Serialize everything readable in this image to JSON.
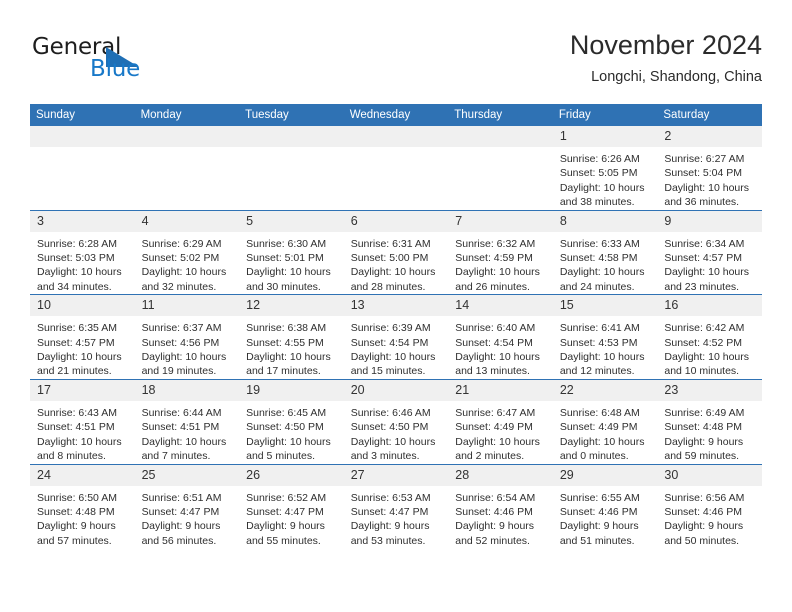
{
  "logo": {
    "word_one": "General",
    "word_two": "Blue",
    "triangle_icon": "blue-triangle-icon",
    "brand_blue": "#1878c8",
    "triangle_blue": "#1f6fb5"
  },
  "header": {
    "title": "November 2024",
    "subtitle": "Longchi, Shandong, China"
  },
  "theme": {
    "header_blue": "#2f72b4",
    "daynum_bg": "#f0f0f0",
    "page_bg": "#ffffff"
  },
  "calendar": {
    "weekday_headers": [
      "Sunday",
      "Monday",
      "Tuesday",
      "Wednesday",
      "Thursday",
      "Friday",
      "Saturday"
    ],
    "weeks": [
      [
        {
          "day": "",
          "empty": true
        },
        {
          "day": "",
          "empty": true
        },
        {
          "day": "",
          "empty": true
        },
        {
          "day": "",
          "empty": true
        },
        {
          "day": "",
          "empty": true
        },
        {
          "day": "1",
          "sunrise": "Sunrise: 6:26 AM",
          "sunset": "Sunset: 5:05 PM",
          "daylight": "Daylight: 10 hours and 38 minutes."
        },
        {
          "day": "2",
          "sunrise": "Sunrise: 6:27 AM",
          "sunset": "Sunset: 5:04 PM",
          "daylight": "Daylight: 10 hours and 36 minutes."
        }
      ],
      [
        {
          "day": "3",
          "sunrise": "Sunrise: 6:28 AM",
          "sunset": "Sunset: 5:03 PM",
          "daylight": "Daylight: 10 hours and 34 minutes."
        },
        {
          "day": "4",
          "sunrise": "Sunrise: 6:29 AM",
          "sunset": "Sunset: 5:02 PM",
          "daylight": "Daylight: 10 hours and 32 minutes."
        },
        {
          "day": "5",
          "sunrise": "Sunrise: 6:30 AM",
          "sunset": "Sunset: 5:01 PM",
          "daylight": "Daylight: 10 hours and 30 minutes."
        },
        {
          "day": "6",
          "sunrise": "Sunrise: 6:31 AM",
          "sunset": "Sunset: 5:00 PM",
          "daylight": "Daylight: 10 hours and 28 minutes."
        },
        {
          "day": "7",
          "sunrise": "Sunrise: 6:32 AM",
          "sunset": "Sunset: 4:59 PM",
          "daylight": "Daylight: 10 hours and 26 minutes."
        },
        {
          "day": "8",
          "sunrise": "Sunrise: 6:33 AM",
          "sunset": "Sunset: 4:58 PM",
          "daylight": "Daylight: 10 hours and 24 minutes."
        },
        {
          "day": "9",
          "sunrise": "Sunrise: 6:34 AM",
          "sunset": "Sunset: 4:57 PM",
          "daylight": "Daylight: 10 hours and 23 minutes."
        }
      ],
      [
        {
          "day": "10",
          "sunrise": "Sunrise: 6:35 AM",
          "sunset": "Sunset: 4:57 PM",
          "daylight": "Daylight: 10 hours and 21 minutes."
        },
        {
          "day": "11",
          "sunrise": "Sunrise: 6:37 AM",
          "sunset": "Sunset: 4:56 PM",
          "daylight": "Daylight: 10 hours and 19 minutes."
        },
        {
          "day": "12",
          "sunrise": "Sunrise: 6:38 AM",
          "sunset": "Sunset: 4:55 PM",
          "daylight": "Daylight: 10 hours and 17 minutes."
        },
        {
          "day": "13",
          "sunrise": "Sunrise: 6:39 AM",
          "sunset": "Sunset: 4:54 PM",
          "daylight": "Daylight: 10 hours and 15 minutes."
        },
        {
          "day": "14",
          "sunrise": "Sunrise: 6:40 AM",
          "sunset": "Sunset: 4:54 PM",
          "daylight": "Daylight: 10 hours and 13 minutes."
        },
        {
          "day": "15",
          "sunrise": "Sunrise: 6:41 AM",
          "sunset": "Sunset: 4:53 PM",
          "daylight": "Daylight: 10 hours and 12 minutes."
        },
        {
          "day": "16",
          "sunrise": "Sunrise: 6:42 AM",
          "sunset": "Sunset: 4:52 PM",
          "daylight": "Daylight: 10 hours and 10 minutes."
        }
      ],
      [
        {
          "day": "17",
          "sunrise": "Sunrise: 6:43 AM",
          "sunset": "Sunset: 4:51 PM",
          "daylight": "Daylight: 10 hours and 8 minutes."
        },
        {
          "day": "18",
          "sunrise": "Sunrise: 6:44 AM",
          "sunset": "Sunset: 4:51 PM",
          "daylight": "Daylight: 10 hours and 7 minutes."
        },
        {
          "day": "19",
          "sunrise": "Sunrise: 6:45 AM",
          "sunset": "Sunset: 4:50 PM",
          "daylight": "Daylight: 10 hours and 5 minutes."
        },
        {
          "day": "20",
          "sunrise": "Sunrise: 6:46 AM",
          "sunset": "Sunset: 4:50 PM",
          "daylight": "Daylight: 10 hours and 3 minutes."
        },
        {
          "day": "21",
          "sunrise": "Sunrise: 6:47 AM",
          "sunset": "Sunset: 4:49 PM",
          "daylight": "Daylight: 10 hours and 2 minutes."
        },
        {
          "day": "22",
          "sunrise": "Sunrise: 6:48 AM",
          "sunset": "Sunset: 4:49 PM",
          "daylight": "Daylight: 10 hours and 0 minutes."
        },
        {
          "day": "23",
          "sunrise": "Sunrise: 6:49 AM",
          "sunset": "Sunset: 4:48 PM",
          "daylight": "Daylight: 9 hours and 59 minutes."
        }
      ],
      [
        {
          "day": "24",
          "sunrise": "Sunrise: 6:50 AM",
          "sunset": "Sunset: 4:48 PM",
          "daylight": "Daylight: 9 hours and 57 minutes."
        },
        {
          "day": "25",
          "sunrise": "Sunrise: 6:51 AM",
          "sunset": "Sunset: 4:47 PM",
          "daylight": "Daylight: 9 hours and 56 minutes."
        },
        {
          "day": "26",
          "sunrise": "Sunrise: 6:52 AM",
          "sunset": "Sunset: 4:47 PM",
          "daylight": "Daylight: 9 hours and 55 minutes."
        },
        {
          "day": "27",
          "sunrise": "Sunrise: 6:53 AM",
          "sunset": "Sunset: 4:47 PM",
          "daylight": "Daylight: 9 hours and 53 minutes."
        },
        {
          "day": "28",
          "sunrise": "Sunrise: 6:54 AM",
          "sunset": "Sunset: 4:46 PM",
          "daylight": "Daylight: 9 hours and 52 minutes."
        },
        {
          "day": "29",
          "sunrise": "Sunrise: 6:55 AM",
          "sunset": "Sunset: 4:46 PM",
          "daylight": "Daylight: 9 hours and 51 minutes."
        },
        {
          "day": "30",
          "sunrise": "Sunrise: 6:56 AM",
          "sunset": "Sunset: 4:46 PM",
          "daylight": "Daylight: 9 hours and 50 minutes."
        }
      ]
    ]
  }
}
